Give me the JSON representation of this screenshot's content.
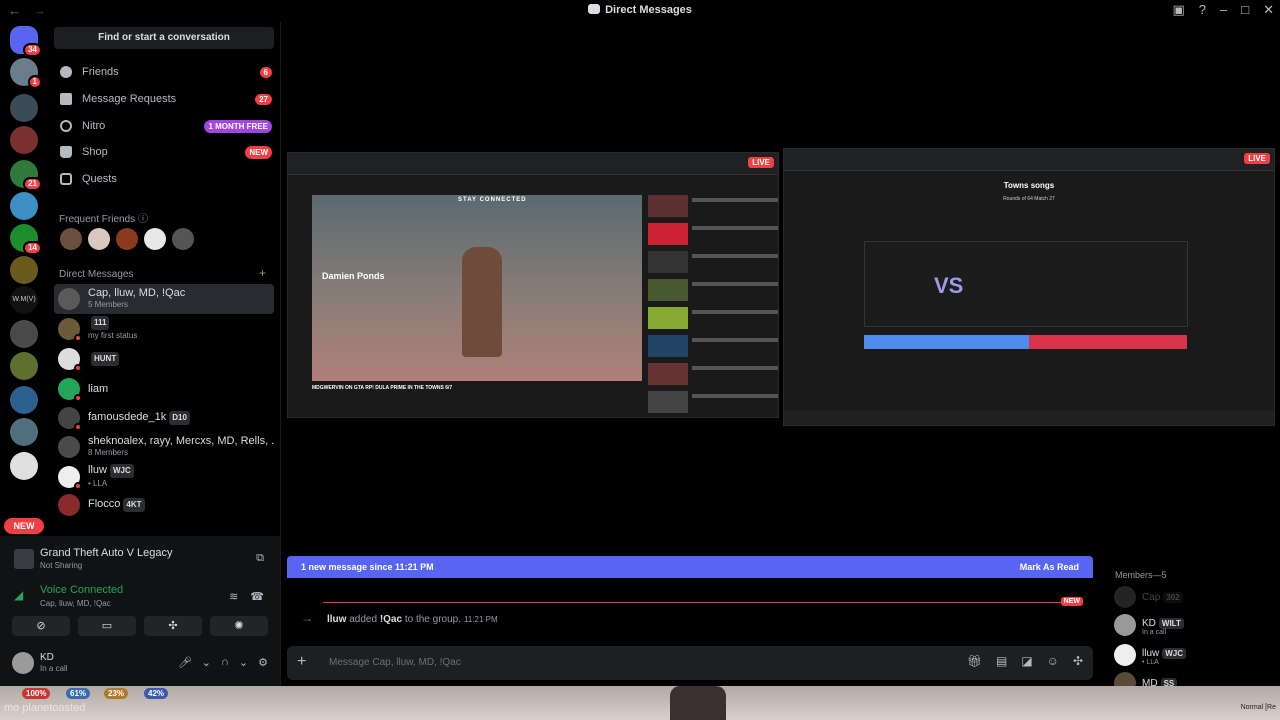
{
  "window": {
    "title": "Direct Messages"
  },
  "search": {
    "label": "Find or start a conversation"
  },
  "servers": [
    {
      "badge": "34"
    },
    {
      "badge": "1"
    },
    {
      "badge": ""
    },
    {
      "badge": ""
    },
    {
      "badge": "21"
    },
    {
      "badge": ""
    },
    {
      "badge": "14"
    },
    {
      "badge": ""
    },
    {
      "badge": ""
    },
    {
      "badge": ""
    },
    {
      "badge": ""
    },
    {
      "badge": ""
    },
    {
      "badge": ""
    },
    {
      "badge": ""
    }
  ],
  "rail_new": "NEW",
  "server_label_text": "W.M(V)",
  "nav": {
    "friends": {
      "label": "Friends",
      "count": "6"
    },
    "requests": {
      "label": "Message Requests",
      "count": "27"
    },
    "nitro": {
      "label": "Nitro",
      "pill": "1 MONTH FREE"
    },
    "shop": {
      "label": "Shop",
      "pill": "NEW"
    },
    "quests": {
      "label": "Quests"
    }
  },
  "frequent_friends_label": "Frequent Friends",
  "direct_messages_label": "Direct Messages",
  "dms": [
    {
      "name": "Cap, lluw, MD, !Qac",
      "sub": "5 Members",
      "tag": ""
    },
    {
      "name": "",
      "tag": "111",
      "sub": "my first status"
    },
    {
      "name": "",
      "tag": "HUNT",
      "sub": ""
    },
    {
      "name": "liam",
      "tag": "",
      "sub": ""
    },
    {
      "name": "famousdede_1k",
      "tag": "D10",
      "sub": ""
    },
    {
      "name": "sheknoalex, rayy, Mercxs, MD, Rells, ...",
      "tag": "",
      "sub": "8 Members"
    },
    {
      "name": "lluw",
      "tag": "WJC",
      "sub": "• LLA"
    },
    {
      "name": "Flocco",
      "tag": "4KT",
      "sub": ""
    }
  ],
  "activity": {
    "title": "Grand Theft Auto V Legacy",
    "sub": "Not Sharing"
  },
  "voice": {
    "title": "Voice Connected",
    "sub": "Cap, lluw, MD, !Qac"
  },
  "me": {
    "name": "KD",
    "status": "In a call"
  },
  "streams": {
    "left": {
      "live": "LIVE",
      "overlay": "Damien Ponds",
      "top_text": "STAY CONNECTED",
      "caption": "MDGWERVIN ON GTA RP! DULA PRIME IN THE TOWNS 6/7",
      "side_items": 10
    },
    "right": {
      "live": "LIVE",
      "title": "Towns songs",
      "round": "Rounds of 64 Match 27",
      "vs": "VS"
    }
  },
  "banner": {
    "left": "1 new message since 11:21 PM",
    "right": "Mark As Read"
  },
  "new_marker": "NEW",
  "system_message": {
    "user": "lluw",
    "verb": "added",
    "target": "!Qac",
    "rest": "to the group.",
    "time": "11:21 PM"
  },
  "composer": {
    "placeholder": "Message Cap, lluw, MD, !Qac"
  },
  "members": {
    "header": "Members—5",
    "list": [
      {
        "name": "Cap",
        "tag": "302",
        "sub": ""
      },
      {
        "name": "KD",
        "tag": "WILT",
        "sub": "In a call"
      },
      {
        "name": "lluw",
        "tag": "WJC",
        "sub": "• LLA"
      },
      {
        "name": "MD",
        "tag": "SS",
        "sub": ""
      }
    ]
  },
  "game_overlay": {
    "percents": [
      "100%",
      "61%",
      "23%",
      "42%"
    ],
    "ghost_text": "mo planetoasted",
    "corner": "Normal [Re"
  },
  "colors": {
    "accent": "#5865f2",
    "danger": "#f23f43",
    "online": "#23a55a",
    "nitro": "#a144e0"
  }
}
